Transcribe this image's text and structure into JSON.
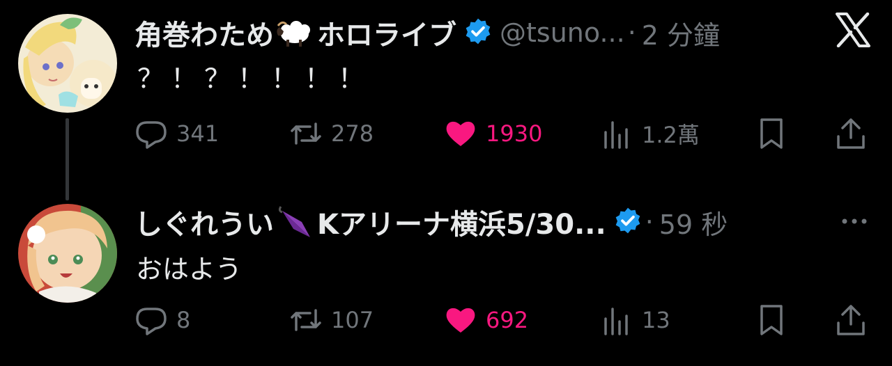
{
  "tweets": [
    {
      "name": "角巻わため",
      "name_suffix": "ホロライブ",
      "handle": "@tsuno...",
      "separator": "·",
      "time": "2 分鐘",
      "text": "？！？！！！！",
      "replies": "341",
      "retweets": "278",
      "likes": "1930",
      "views": "1.2萬"
    },
    {
      "name": "しぐれうい",
      "name_suffix": "Kアリーナ横浜5/30...",
      "separator": "·",
      "time": "59 秒",
      "text": "おはよう",
      "replies": "8",
      "retweets": "107",
      "likes": "692",
      "views": "13"
    }
  ],
  "icons": {
    "sheep": "sheep-emoji",
    "umbrella": "closed-umbrella-emoji",
    "verified": "verified-badge-icon",
    "reply": "reply-icon",
    "retweet": "retweet-icon",
    "like": "heart-icon",
    "views": "views-icon",
    "bookmark": "bookmark-icon",
    "share": "share-icon",
    "x_logo": "x-logo-icon",
    "more": "more-icon"
  },
  "colors": {
    "background": "#000000",
    "text": "#e7e9ea",
    "muted": "#71767b",
    "like": "#f91880",
    "verified": "#1d9bf0"
  }
}
